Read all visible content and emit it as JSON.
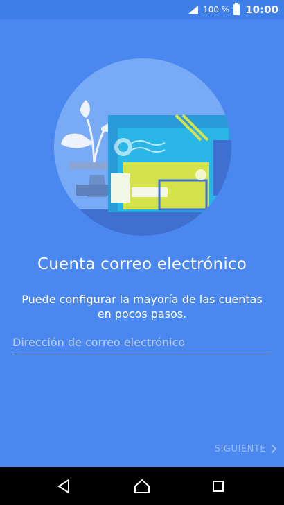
{
  "status_bar": {
    "battery": "100 %",
    "time": "10:00",
    "icons": [
      "signal-icon",
      "battery-icon"
    ]
  },
  "main": {
    "title": "Cuenta correo electrónico",
    "subtitle": "Puede configurar la mayoría de las cuentas en pocos pasos.",
    "email_placeholder": "Dirección de correo electrónico",
    "email_value": "",
    "next_label": "SIGUIENTE"
  },
  "nav": {
    "icons": [
      "back-icon",
      "home-icon",
      "recents-icon"
    ]
  },
  "colors": {
    "background": "#4a87ee",
    "circle": "#79aaf5",
    "teal_card": "#29b6e6",
    "yellow_card": "#d4e34b"
  }
}
